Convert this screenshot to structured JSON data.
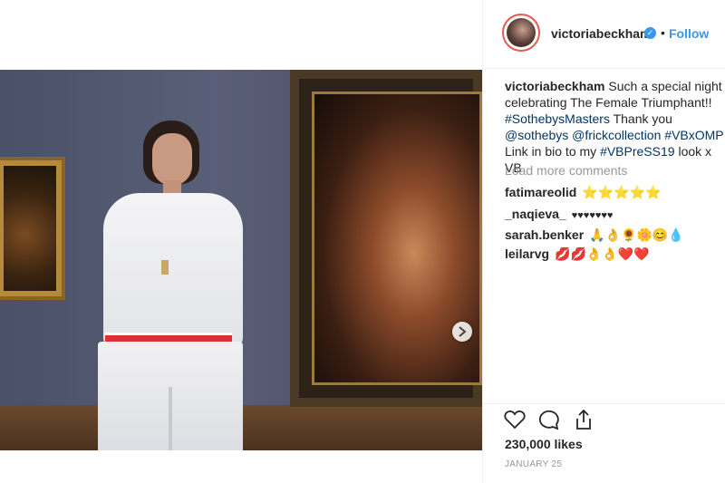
{
  "post": {
    "username": "victoriabeckham",
    "follow_label": "Follow",
    "separator": "•",
    "caption": {
      "user": "victoriabeckham",
      "text1": "Such a special night celebrating The Female Triumphant!!",
      "tag1": "#SothebysMasters",
      "text2": "Thank you",
      "tag2": "@sothebys",
      "tag3": "@frickcollection",
      "tag4": "#VBxOMP",
      "text3": "Link in bio to my",
      "tag5": "#VBPreSS19",
      "text4": "look x VB"
    },
    "load_more": "Load more comments",
    "comments": [
      {
        "user": "fatimareolid",
        "text": "⭐⭐⭐⭐⭐"
      },
      {
        "user": "_naqieva_",
        "text": "♥♥♥♥♥♥♥"
      },
      {
        "user": "sarah.benker",
        "text": "🙏👌🌻🌼😊💧"
      },
      {
        "user": "leilarvg",
        "text": "💋💋👌👌❤️❤️"
      }
    ],
    "likes": "230,000 likes",
    "date": "JANUARY 25",
    "icons": {
      "like": "heart-icon",
      "comment": "comment-bubble-icon",
      "share": "share-icon",
      "carousel": "chevron-right-icon",
      "verified": "verified-badge-icon"
    },
    "colors": {
      "link": "#3897f0",
      "tag": "#003569",
      "muted": "#999999"
    }
  }
}
